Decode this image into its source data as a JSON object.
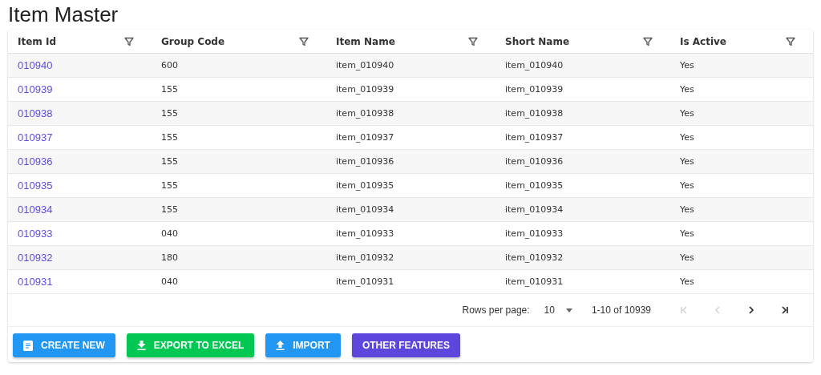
{
  "title": "Item Master",
  "table": {
    "columns": [
      "Item Id",
      "Group Code",
      "Item Name",
      "Short Name",
      "Is Active"
    ],
    "rows": [
      [
        "010940",
        "600",
        "item_010940",
        "item_010940",
        "Yes"
      ],
      [
        "010939",
        "155",
        "item_010939",
        "item_010939",
        "Yes"
      ],
      [
        "010938",
        "155",
        "item_010938",
        "item_010938",
        "Yes"
      ],
      [
        "010937",
        "155",
        "item_010937",
        "item_010937",
        "Yes"
      ],
      [
        "010936",
        "155",
        "item_010936",
        "item_010936",
        "Yes"
      ],
      [
        "010935",
        "155",
        "item_010935",
        "item_010935",
        "Yes"
      ],
      [
        "010934",
        "155",
        "item_010934",
        "item_010934",
        "Yes"
      ],
      [
        "010933",
        "040",
        "item_010933",
        "item_010933",
        "Yes"
      ],
      [
        "010932",
        "180",
        "item_010932",
        "item_010932",
        "Yes"
      ],
      [
        "010931",
        "040",
        "item_010931",
        "item_010931",
        "Yes"
      ]
    ]
  },
  "pagination": {
    "rows_per_page_label": "Rows per page:",
    "rows_per_page": "10",
    "range": "1-10 of 10939",
    "nav": [
      {
        "kind": "first",
        "disabled": true
      },
      {
        "kind": "prev",
        "disabled": true
      },
      {
        "kind": "next",
        "disabled": false
      },
      {
        "kind": "last",
        "disabled": false
      }
    ]
  },
  "buttons": [
    {
      "label": "CREATE NEW",
      "kind": "document",
      "color": "#2196f3"
    },
    {
      "label": "EXPORT TO EXCEL",
      "kind": "download",
      "color": "#00c853"
    },
    {
      "label": "IMPORT",
      "kind": "upload",
      "color": "#2196f3"
    },
    {
      "label": "OTHER FEATURES",
      "kind": "text",
      "color": "#5c46dc"
    }
  ]
}
